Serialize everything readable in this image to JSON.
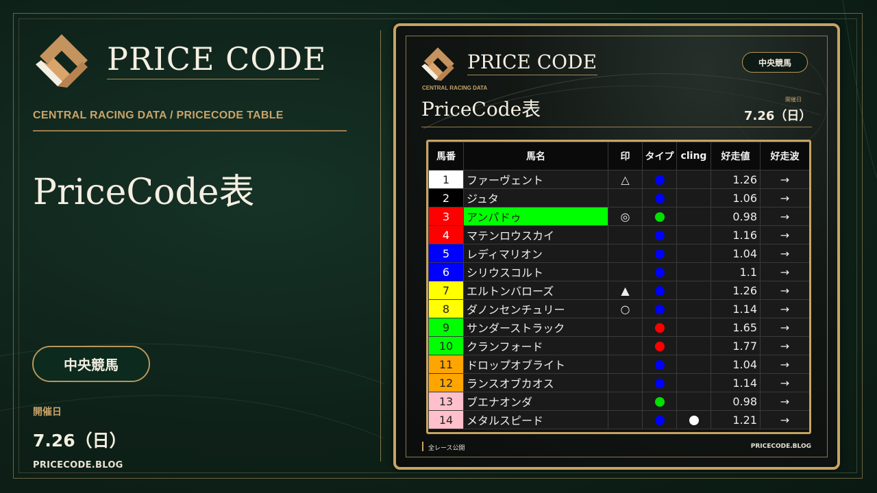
{
  "left": {
    "brand": "PRICE CODE",
    "subtitle": "CENTRAL RACING DATA  /  PRICECODE TABLE",
    "title": "PriceCode表",
    "venue": "中央競馬",
    "date_label": "開催日",
    "date": "7.26（日）",
    "site": "PRICECODE.BLOG"
  },
  "card": {
    "brand": "PRICE CODE",
    "venue": "中央競馬",
    "subtitle": "CENTRAL RACING DATA",
    "title": "PriceCode表",
    "date_label": "開催日",
    "date": "7.26（日）",
    "footer_left": "全レース公開",
    "footer_right": "PRICECODE.BLOG"
  },
  "colors": {
    "gold": "#c7a462",
    "background": "#0f2219",
    "type_dot_blue": "#0000ff",
    "type_dot_green": "#00e000",
    "type_dot_red": "#ff0000",
    "cling_dot_white": "#ffffff",
    "name_highlight_green": "#00ff00"
  },
  "table": {
    "headers": [
      "馬番",
      "馬名",
      "印",
      "タイプ",
      "cling",
      "好走値",
      "好走波"
    ],
    "rows": [
      {
        "num": "1",
        "num_bg": "#ffffff",
        "num_fg": "#222222",
        "name": "ファーヴェント",
        "mark": "△",
        "type": "blue",
        "cling": "",
        "value": "1.26",
        "trend": "→"
      },
      {
        "num": "2",
        "num_bg": "#000000",
        "num_fg": "#ffffff",
        "name": "ジュタ",
        "mark": "",
        "type": "blue",
        "cling": "",
        "value": "1.06",
        "trend": "→"
      },
      {
        "num": "3",
        "num_bg": "#ff0000",
        "num_fg": "#ffffff",
        "name": "アンパドゥ",
        "name_highlight": "green",
        "mark": "◎",
        "type": "green",
        "cling": "",
        "value": "0.98",
        "trend": "→"
      },
      {
        "num": "4",
        "num_bg": "#ff0000",
        "num_fg": "#ffffff",
        "name": "マテンロウスカイ",
        "mark": "",
        "type": "blue",
        "cling": "",
        "value": "1.16",
        "trend": "→"
      },
      {
        "num": "5",
        "num_bg": "#0000ff",
        "num_fg": "#ffffff",
        "name": "レディマリオン",
        "mark": "",
        "type": "blue",
        "cling": "",
        "value": "1.04",
        "trend": "→"
      },
      {
        "num": "6",
        "num_bg": "#0000ff",
        "num_fg": "#ffffff",
        "name": "シリウスコルト",
        "mark": "",
        "type": "blue",
        "cling": "",
        "value": "1.1",
        "trend": "→"
      },
      {
        "num": "7",
        "num_bg": "#ffff00",
        "num_fg": "#222222",
        "name": "エルトンバローズ",
        "mark": "▲",
        "type": "blue",
        "cling": "",
        "value": "1.26",
        "trend": "→"
      },
      {
        "num": "8",
        "num_bg": "#ffff00",
        "num_fg": "#222222",
        "name": "ダノンセンチュリー",
        "mark": "○",
        "type": "blue",
        "cling": "",
        "value": "1.14",
        "trend": "→"
      },
      {
        "num": "9",
        "num_bg": "#00ff00",
        "num_fg": "#222222",
        "name": "サンダーストラック",
        "mark": "",
        "type": "red",
        "cling": "",
        "value": "1.65",
        "trend": "→"
      },
      {
        "num": "10",
        "num_bg": "#00ff00",
        "num_fg": "#222222",
        "name": "クランフォード",
        "mark": "",
        "type": "red",
        "cling": "",
        "value": "1.77",
        "trend": "→"
      },
      {
        "num": "11",
        "num_bg": "#ffa500",
        "num_fg": "#222222",
        "name": "ドロップオブライト",
        "mark": "",
        "type": "blue",
        "cling": "",
        "value": "1.04",
        "trend": "→"
      },
      {
        "num": "12",
        "num_bg": "#ffa500",
        "num_fg": "#222222",
        "name": "ランスオブカオス",
        "mark": "",
        "type": "blue",
        "cling": "",
        "value": "1.14",
        "trend": "→"
      },
      {
        "num": "13",
        "num_bg": "#ffc0cb",
        "num_fg": "#222222",
        "name": "ブエナオンダ",
        "mark": "",
        "type": "green",
        "cling": "",
        "value": "0.98",
        "trend": "→"
      },
      {
        "num": "14",
        "num_bg": "#ffc0cb",
        "num_fg": "#222222",
        "name": "メタルスピード",
        "mark": "",
        "type": "blue",
        "cling": "white",
        "value": "1.21",
        "trend": "→"
      }
    ]
  }
}
